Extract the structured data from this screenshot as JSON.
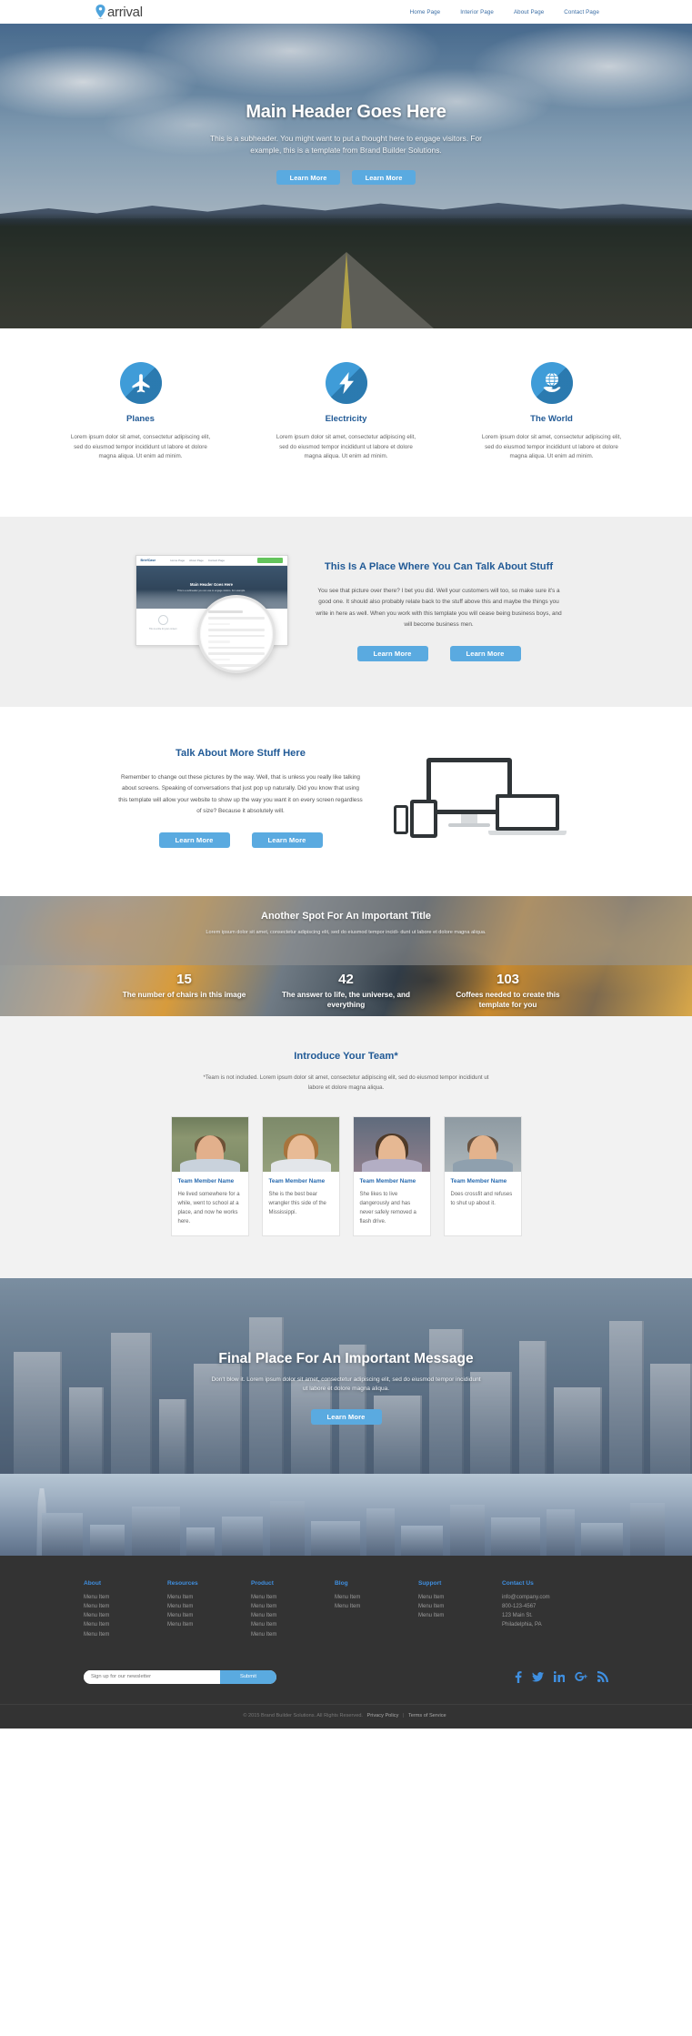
{
  "nav": {
    "brand": "arrival",
    "brand_icon": "map-pin-icon",
    "links": [
      "Home Page",
      "Interior Page",
      "About Page",
      "Contact Page"
    ]
  },
  "hero": {
    "title": "Main Header Goes Here",
    "subtitle": "This is a subheader. You might want to put a thought here to engage visitors. For example, this is a template from Brand Builder Solutions.",
    "button_primary": "Learn More",
    "button_secondary": "Learn More"
  },
  "features": [
    {
      "icon": "airplane-icon",
      "title": "Planes",
      "text": "Lorem ipsum dolor sit amet, consectetur adipiscing elit, sed do eiusmod tempor incididunt ut labore et dolore magna aliqua. Ut enim ad minim."
    },
    {
      "icon": "lightning-bolt-icon",
      "title": "Electricity",
      "text": "Lorem ipsum dolor sit amet, consectetur adipiscing elit, sed do eiusmod tempor incididunt ut labore et dolore magna aliqua. Ut enim ad minim."
    },
    {
      "icon": "globe-in-hand-icon",
      "title": "The World",
      "text": "Lorem ipsum dolor sit amet, consectetur adipiscing elit, sed do eiusmod tempor incididunt ut labore et dolore magna aliqua. Ut enim ad minim."
    }
  ],
  "talk_section": {
    "screenshot": {
      "logo": "BriefCase",
      "nav": [
        "Home Page",
        "About Page",
        "Contact Page"
      ],
      "hero_title": "Main Header Goes Here",
      "hero_sub": "This is a subheader you can use to engage visitors. For example.",
      "cards": [
        "This is a title for your content",
        "This is a title for your content",
        "This is a title for your content"
      ]
    },
    "heading": "This Is A Place Where You Can Talk About Stuff",
    "body": "You see that picture over there? I bet you did. Well your customers will too, so make sure it's a good one. It should also probably relate back to the stuff above this and maybe the things you write in here as well. When you work with this template you will cease being business boys, and will become business men.",
    "button_1": "Learn More",
    "button_2": "Learn More"
  },
  "devices_section": {
    "heading": "Talk About More Stuff Here",
    "body": "Remember to change out these pictures by the way. Well, that is unless you really like talking about screens. Speaking of conversations that just pop up naturally. Did you know that using this template will allow your website to show up the way you want it on every screen regardless of size? Because it absolutely will.",
    "button_1": "Learn More",
    "button_2": "Learn More"
  },
  "stats_section": {
    "title": "Another Spot For An Important Title",
    "subtitle": "Lorem ipsum dolor sit amet, consectetur adipiscing elit, sed do eiusmod tempor incidi- dunt ut labore et dolore magna aliqua.",
    "stats": [
      {
        "number": "15",
        "label": "The number of chairs in this image"
      },
      {
        "number": "42",
        "label": "The answer to life, the universe, and everything"
      },
      {
        "number": "103",
        "label": "Coffees needed to create this template for you"
      }
    ]
  },
  "team_section": {
    "heading": "Introduce Your Team*",
    "subtitle": "*Team is not included. Lorem ipsum dolor sit amet, consectetur adipiscing elit, sed do eiusmod tempor incididunt ut labore et dolore magna aliqua.",
    "members": [
      {
        "name": "Team Member Name",
        "bio": "He lived somewhere for a while, went to school at a place, and now he works here."
      },
      {
        "name": "Team Member Name",
        "bio": "She is the best bear wrangler this side of the Mississippi."
      },
      {
        "name": "Team Member Name",
        "bio": "She likes to live dangerously and has never safely removed a flash drive."
      },
      {
        "name": "Team Member Name",
        "bio": "Does crossfit and refuses to shut up about it."
      }
    ]
  },
  "cta_section": {
    "title": "Final Place For An Important Message",
    "subtitle": "Don't blow it. Lorem ipsum dolor sit amet, consectetur adipiscing elit, sed do eiusmod tempor incididunt ut labore et dolore magna aliqua.",
    "button": "Learn More"
  },
  "footer": {
    "columns": [
      {
        "heading": "About",
        "items": [
          "Menu Item",
          "Menu Item",
          "Menu Item",
          "Menu Item",
          "Menu Item"
        ]
      },
      {
        "heading": "Resources",
        "items": [
          "Menu Item",
          "Menu Item",
          "Menu Item",
          "Menu Item"
        ]
      },
      {
        "heading": "Product",
        "items": [
          "Menu Item",
          "Menu Item",
          "Menu Item",
          "Menu Item",
          "Menu Item"
        ]
      },
      {
        "heading": "Blog",
        "items": [
          "Menu Item",
          "Menu Item"
        ]
      },
      {
        "heading": "Support",
        "items": [
          "Menu Item",
          "Menu Item",
          "Menu Item"
        ]
      },
      {
        "heading": "Contact Us",
        "items": [
          "info@company.com",
          "800-123-4567",
          "123 Main St.",
          "Philadelphia, PA"
        ]
      }
    ],
    "newsletter": {
      "placeholder": "Sign up for our newsletter",
      "value": "",
      "submit_label": "Submit"
    },
    "socials": [
      {
        "name": "facebook-icon",
        "glyph": "f"
      },
      {
        "name": "twitter-icon",
        "glyph": "ᵛ"
      },
      {
        "name": "linkedin-icon",
        "glyph": "in"
      },
      {
        "name": "google-plus-icon",
        "glyph": "g⁺"
      },
      {
        "name": "rss-icon",
        "glyph": "◔"
      }
    ],
    "copyright": "© 2015 Brand Builder Solutions. All Rights Reserved.",
    "privacy_label": "Privacy Policy",
    "separator": "|",
    "terms_label": "Terms of Service"
  },
  "colors": {
    "brand_blue": "#5aaae0",
    "heading_blue": "#215a96",
    "link_blue": "#3f8fe0",
    "footer_bg": "#333333",
    "grey_bg": "#efefef"
  }
}
